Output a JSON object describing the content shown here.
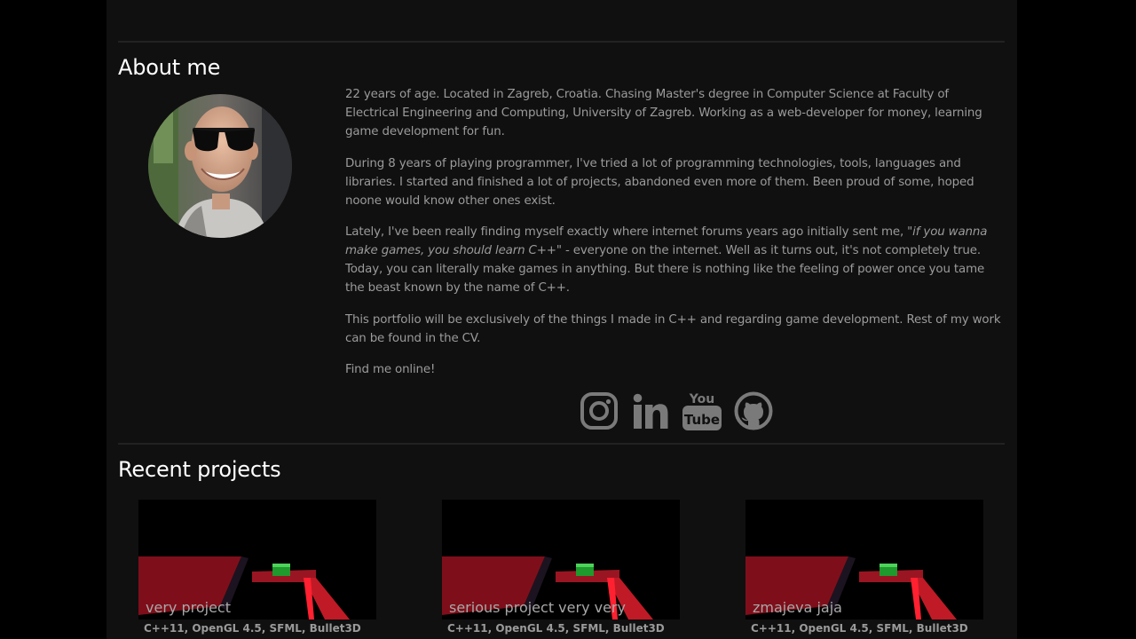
{
  "about": {
    "title": "About me",
    "paragraph_1": "22 years of age. Located in Zagreb, Croatia. Chasing Master's degree in Computer Science at Faculty of Electrical Engineering and Computing, University of Zagreb. Working as a web-developer for money, learning game development for fun.",
    "paragraph_2": "During 8 years of playing programmer, I've tried a lot of programming technologies, tools, languages and libraries. I started and finished a lot of projects, abandoned even more of them. Been proud of some, hoped noone would know other ones exist.",
    "paragraph_3_start": "Lately, I've been really finding myself exactly where internet forums years ago initially sent me, ",
    "paragraph_3_quote": "\"if you wanna make games, you should learn C++\"",
    "paragraph_3_end": " - everyone on the internet. Well as it turns out, it's not completely true. Today, you can literally make games in anything. But there is nothing like the feeling of power once you tame the beast known by the name of C++.",
    "paragraph_4": "This portfolio will be exclusively of the things I made in C++ and regarding game development. Rest of my work can be found in the CV.",
    "find_me": "Find me online!"
  },
  "social": {
    "icons": [
      "instagram-icon",
      "linkedin-icon",
      "youtube-icon",
      "github-icon"
    ],
    "youtube_you": "You",
    "youtube_tube": "Tube"
  },
  "projects": {
    "title": "Recent projects",
    "items": [
      {
        "title": "very project",
        "tech": "C++11, OpenGL 4.5, SFML, Bullet3D"
      },
      {
        "title": "serious project very very",
        "tech": "C++11, OpenGL 4.5, SFML, Bullet3D"
      },
      {
        "title": "zmajeva jaja",
        "tech": "C++11, OpenGL 4.5, SFML, Bullet3D"
      }
    ]
  },
  "colors": {
    "page_background": "#000000",
    "content_background": "#101010",
    "heading": "#ffffff",
    "body_text": "#9b9b9b",
    "icon": "#7a7a7a",
    "divider": "#222222"
  }
}
